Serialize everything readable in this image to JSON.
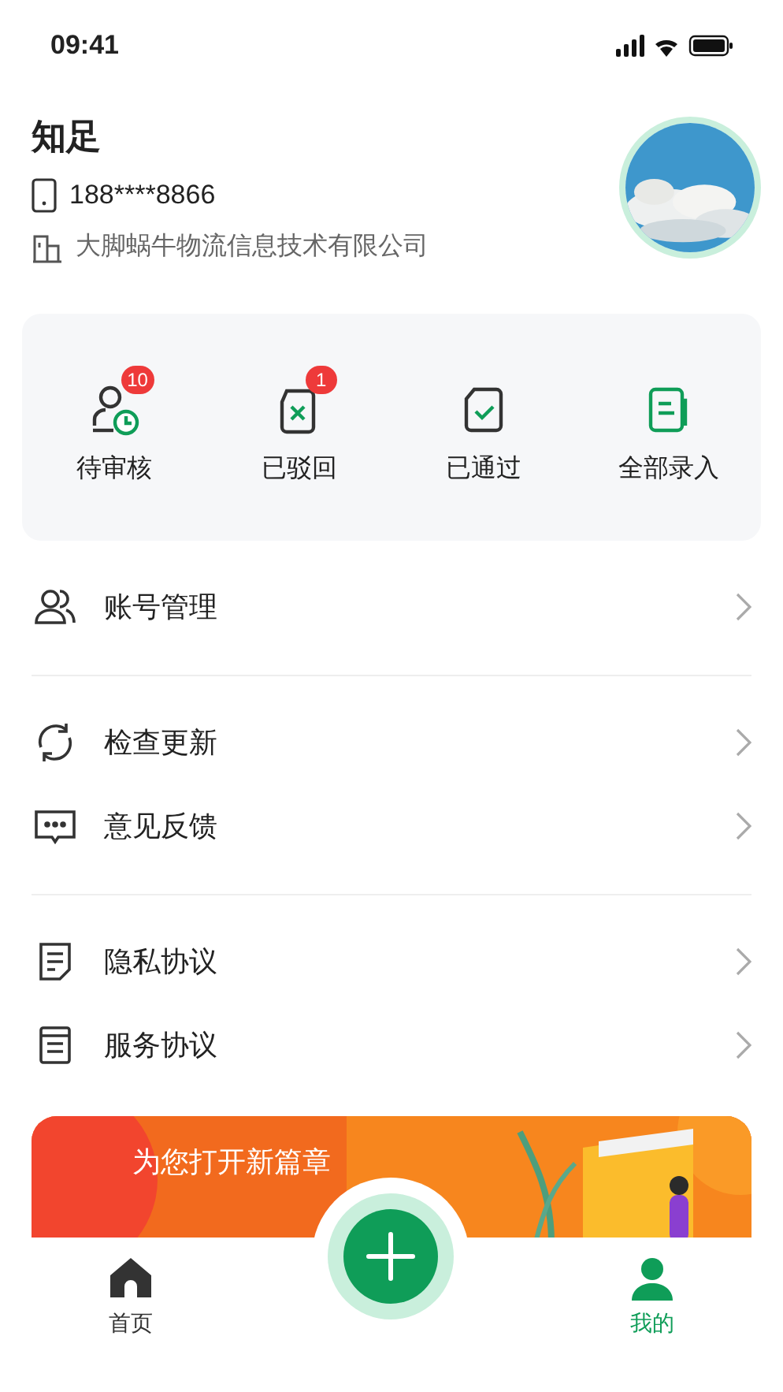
{
  "status_bar": {
    "time": "09:41"
  },
  "profile": {
    "name": "知足",
    "phone": "188****8866",
    "company": "大脚蜗牛物流信息技术有限公司"
  },
  "stats": [
    {
      "kind": "pending",
      "label": "待审核",
      "badge": "10"
    },
    {
      "kind": "rejected",
      "label": "已驳回",
      "badge": "1"
    },
    {
      "kind": "approved",
      "label": "已通过"
    },
    {
      "kind": "all",
      "label": "全部录入"
    }
  ],
  "menu_groups": [
    [
      {
        "kind": "account",
        "label": "账号管理"
      }
    ],
    [
      {
        "kind": "update",
        "label": "检查更新"
      },
      {
        "kind": "feedback",
        "label": "意见反馈"
      }
    ],
    [
      {
        "kind": "privacy",
        "label": "隐私协议"
      },
      {
        "kind": "service",
        "label": "服务协议"
      }
    ]
  ],
  "banner": {
    "subtitle": "为您打开新篇章"
  },
  "tab_bar": [
    {
      "kind": "home",
      "label": "首页",
      "selected": false
    },
    {
      "kind": "add"
    },
    {
      "kind": "me",
      "label": "我的",
      "selected": true
    }
  ]
}
